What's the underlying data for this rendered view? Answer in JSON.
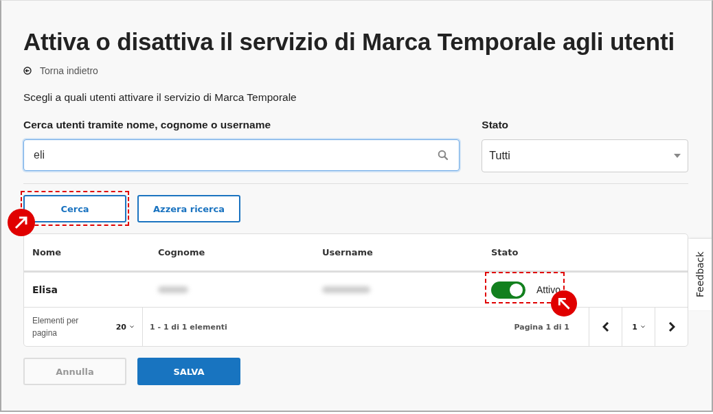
{
  "title": "Attiva o disattiva il servizio di Marca Temporale agli utenti",
  "back_link": "Torna indietro",
  "intro": "Scegli a quali utenti attivare il servizio di Marca Temporale",
  "search": {
    "label": "Cerca utenti tramite nome, cognome o username",
    "value": "eli"
  },
  "status_filter": {
    "label": "Stato",
    "value": "Tutti"
  },
  "search_buttons": [
    {
      "label": "Cerca",
      "highlighted": true
    },
    {
      "label": "Azzera ricerca",
      "highlighted": false
    }
  ],
  "table": {
    "columns": [
      "Nome",
      "Cognome",
      "Username",
      "Stato"
    ],
    "rows": [
      {
        "nome": "Elisa",
        "cognome_blurred": true,
        "username_blurred": true,
        "active": true,
        "status_label": "Attivo",
        "highlighted": true
      }
    ]
  },
  "pagination": {
    "per_page_label": "Elementi per pagina",
    "per_page": "20",
    "range": "1 - 1 di 1 elementi",
    "page_info": "Pagina 1 di 1",
    "page": "1"
  },
  "footer_buttons": [
    {
      "label": "Annulla",
      "disabled": true,
      "primary": false
    },
    {
      "label": "SALVA",
      "disabled": false,
      "primary": true
    }
  ],
  "feedback_tab": "Feedback"
}
